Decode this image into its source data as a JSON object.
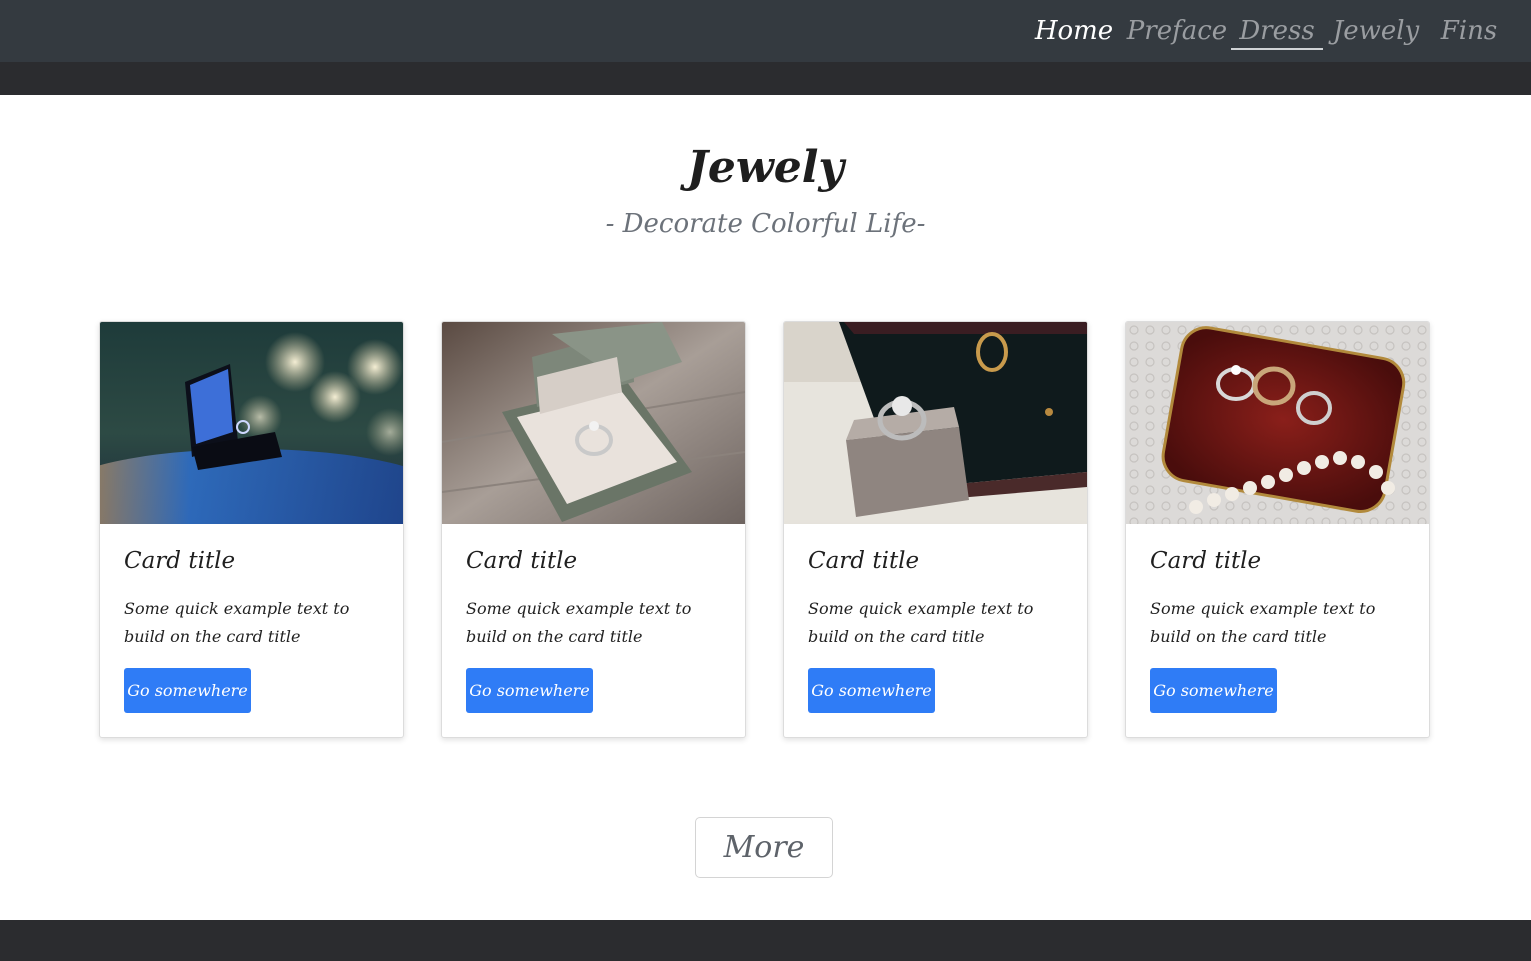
{
  "nav": {
    "items": [
      {
        "label": "Home",
        "state": "active"
      },
      {
        "label": "Preface",
        "state": "default"
      },
      {
        "label": "Dress",
        "state": "underlined"
      },
      {
        "label": "Jewely",
        "state": "default"
      },
      {
        "label": "Fins",
        "state": "default"
      }
    ]
  },
  "section": {
    "title": "Jewely",
    "subtitle": "- Decorate Colorful Life-"
  },
  "cards": [
    {
      "image_icon": "ring-box-bokeh-image",
      "title": "Card title",
      "text": "Some quick example text to build on the card title",
      "button_label": "Go somewhere"
    },
    {
      "image_icon": "ring-in-green-box-image",
      "title": "Card title",
      "text": "Some quick example text to build on the card title",
      "button_label": "Go somewhere"
    },
    {
      "image_icon": "diamond-ring-velvet-box-image",
      "title": "Card title",
      "text": "Some quick example text to build on the card title",
      "button_label": "Go somewhere"
    },
    {
      "image_icon": "rings-on-red-pillow-image",
      "title": "Card title",
      "text": "Some quick example text to build on the card title",
      "button_label": "Go somewhere"
    }
  ],
  "more_button": {
    "label": "More"
  },
  "colors": {
    "navbar": "#343a40",
    "strip": "#2b2c2f",
    "primary_button": "#2f7cf6",
    "footer": "#2b2c2f"
  }
}
